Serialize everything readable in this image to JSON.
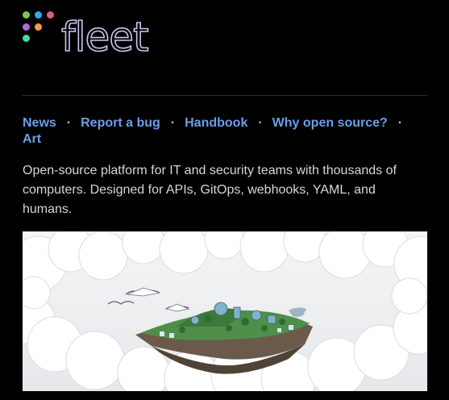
{
  "brand": {
    "name": "fleet",
    "dot_colors": [
      "#7cc94a",
      "#3aa5e6",
      "#d9607a",
      "#b468dc",
      "#f2994a",
      "#3ed9b2"
    ]
  },
  "nav": {
    "links": [
      {
        "label": "News"
      },
      {
        "label": "Report a bug"
      },
      {
        "label": "Handbook"
      },
      {
        "label": "Why open source?"
      },
      {
        "label": "Art"
      }
    ],
    "separator": "·"
  },
  "description": "Open-source platform for IT and security teams with thousands of computers. Designed for APIs, GitOps, webhooks, YAML, and humans.",
  "colors": {
    "background": "#000000",
    "link": "#6a9fe8",
    "text": "#d6d6dc"
  }
}
